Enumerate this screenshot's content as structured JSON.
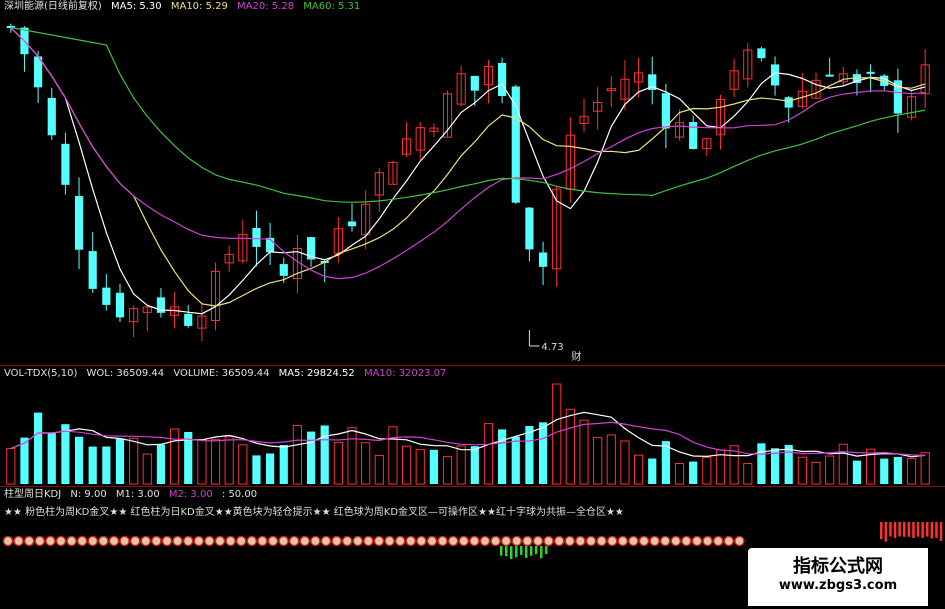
{
  "header": {
    "stock": "深圳能源(日线前复权)",
    "ma5": "MA5: 5.30",
    "ma10": "MA10: 5.29",
    "ma20": "MA20: 5.28",
    "ma60": "MA60: 5.31"
  },
  "annotations": {
    "low_price": "4.73",
    "cai_marker": "财"
  },
  "vol_header": {
    "name": "VOL-TDX(5,10)",
    "wol": "WOL: 36509.44",
    "volume": "VOLUME: 36509.44",
    "ma5": "MA5: 29824.52",
    "ma10": "MA10: 32023.07"
  },
  "kdj_header": {
    "name": "柱型周日KDJ",
    "n": "N: 9.00",
    "m1": "M1: 3.00",
    "m2": "M2: 3.00",
    "extra": ": 50.00"
  },
  "legend": "★★ 粉色柱为周KD金叉★★ 红色柱为日KD金叉★★黄色块为轻仓提示★★ 红色球为周KD金叉区—可操作区★★红十字球为共振—全仓区★★",
  "watermark": {
    "title": "指标公式网",
    "url": "www.zbgs3.com"
  },
  "colors": {
    "up": "#ff3030",
    "down": "#54ffff",
    "ma5": "#ffffff",
    "ma10": "#f0e080",
    "ma20": "#d040d0",
    "ma60": "#40c040",
    "separator": "#8a1010"
  },
  "chart_data": {
    "type": "candlestick",
    "price_points": [
      5.95,
      5.85,
      5.7,
      5.5,
      5.3,
      5.1,
      4.95,
      4.85,
      4.83,
      4.82,
      4.85,
      4.84,
      4.82,
      4.8,
      4.85,
      4.92,
      5.05,
      5.15,
      5.1,
      5.0,
      4.95,
      5.1,
      5.05,
      5.0,
      5.15,
      5.2,
      5.3,
      5.35,
      5.45,
      5.5,
      5.55,
      5.6,
      5.65,
      5.75,
      5.7,
      5.8,
      5.65,
      5.3,
      5.1,
      5.0,
      5.3,
      5.5,
      5.6,
      5.65,
      5.7,
      5.75,
      5.75,
      5.7,
      5.6,
      5.55,
      5.5,
      5.45,
      5.7,
      5.8,
      5.82,
      5.78,
      5.72,
      5.65,
      5.7,
      5.75,
      5.8,
      5.76,
      5.7,
      5.72,
      5.68,
      5.65,
      5.7,
      5.75
    ],
    "low_price": 4.73,
    "vol_ma5": 29824.52,
    "vol_ma10": 32023.07,
    "volume": 36509.44
  }
}
